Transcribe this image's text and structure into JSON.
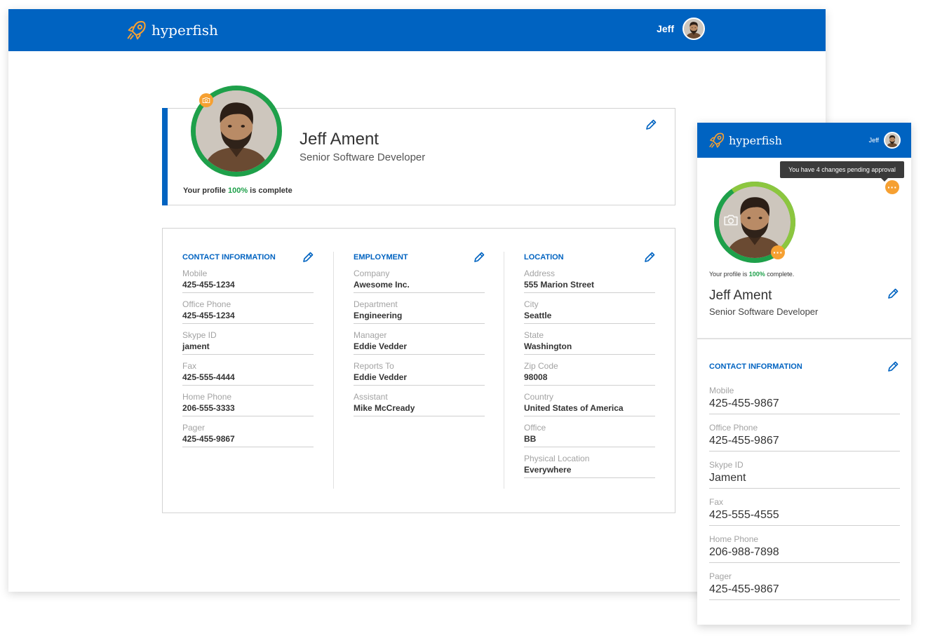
{
  "desktop": {
    "header": {
      "brand": "hyperfish",
      "user_name": "Jeff"
    },
    "profile": {
      "name": "Jeff Ament",
      "title": "Senior Software Developer",
      "complete_prefix": "Your profile ",
      "complete_pct": "100%",
      "complete_suffix": " is complete"
    },
    "sections": [
      {
        "title": "CONTACT INFORMATION",
        "fields": [
          {
            "label": "Mobile",
            "value": "425-455-1234"
          },
          {
            "label": "Office Phone",
            "value": "425-455-1234"
          },
          {
            "label": "Skype ID",
            "value": "jament"
          },
          {
            "label": "Fax",
            "value": "425-555-4444"
          },
          {
            "label": "Home Phone",
            "value": "206-555-3333"
          },
          {
            "label": "Pager",
            "value": "425-455-9867"
          }
        ]
      },
      {
        "title": "EMPLOYMENT",
        "fields": [
          {
            "label": "Company",
            "value": "Awesome Inc."
          },
          {
            "label": "Department",
            "value": "Engineering"
          },
          {
            "label": "Manager",
            "value": "Eddie Vedder"
          },
          {
            "label": "Reports To",
            "value": "Eddie Vedder"
          },
          {
            "label": "Assistant",
            "value": "Mike McCready"
          }
        ]
      },
      {
        "title": "LOCATION",
        "fields": [
          {
            "label": "Address",
            "value": "555 Marion Street"
          },
          {
            "label": "City",
            "value": "Seattle"
          },
          {
            "label": "State",
            "value": "Washington"
          },
          {
            "label": "Zip Code",
            "value": "98008"
          },
          {
            "label": "Country",
            "value": "United States of America"
          },
          {
            "label": "Office",
            "value": "BB"
          },
          {
            "label": "Physical Location",
            "value": "Everywhere"
          }
        ]
      }
    ]
  },
  "mobile": {
    "header": {
      "brand": "hyperfish",
      "user_name": "Jeff"
    },
    "tooltip": "You have 4 changes pending approval",
    "profile": {
      "complete_prefix": "Your profile is ",
      "complete_pct": "100%",
      "complete_suffix": " complete.",
      "name": "Jeff Ament",
      "title": "Senior Software Developer"
    },
    "section_title": "CONTACT INFORMATION",
    "fields": [
      {
        "label": "Mobile",
        "value": "425-455-9867"
      },
      {
        "label": "Office Phone",
        "value": "425-455-9867"
      },
      {
        "label": "Skype ID",
        "value": "Jament"
      },
      {
        "label": "Fax",
        "value": "425-555-4555"
      },
      {
        "label": "Home Phone",
        "value": "206-988-7898"
      },
      {
        "label": "Pager",
        "value": "425-455-9867"
      }
    ]
  },
  "colors": {
    "brand_blue": "#0063c1",
    "complete_green": "#1ea04a",
    "badge_orange": "#f6a031"
  }
}
